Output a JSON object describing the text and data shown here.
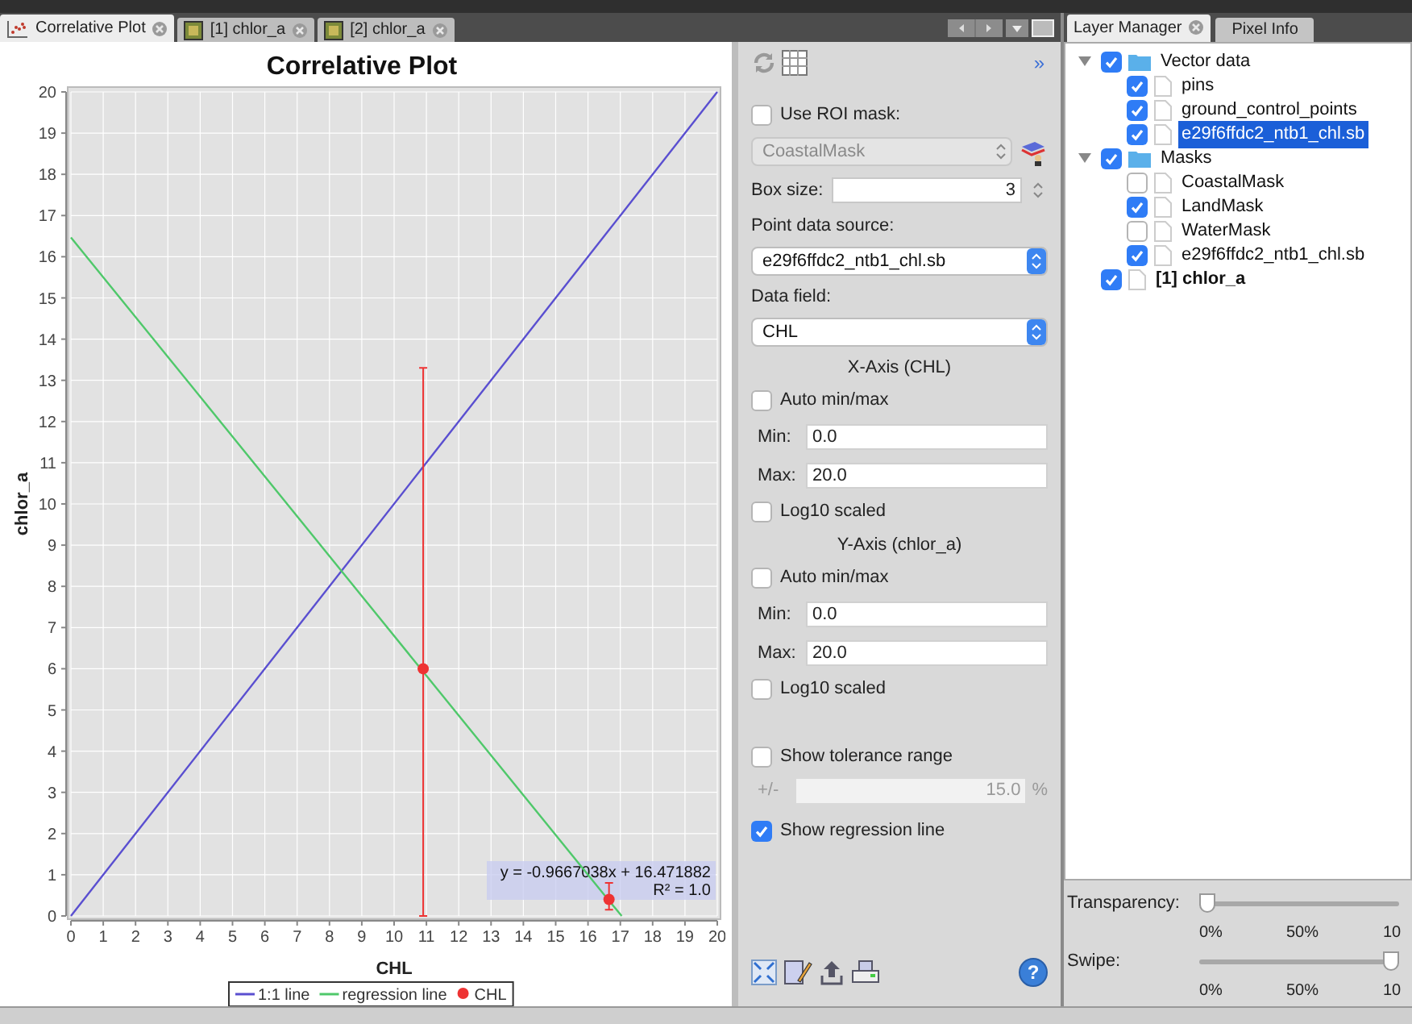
{
  "tabs": [
    {
      "label": "Correlative Plot",
      "kind": "plot",
      "selected": true
    },
    {
      "label": "[1] chlor_a",
      "kind": "image",
      "selected": false
    },
    {
      "label": "[2] chlor_a",
      "kind": "image",
      "selected": false
    }
  ],
  "chart": {
    "chart_data": {
      "type": "scatter",
      "title": "Correlative Plot",
      "xlabel": "CHL",
      "ylabel": "chlor_a",
      "x": [
        0,
        10.9,
        16.65,
        17.04,
        20
      ],
      "series": [
        {
          "name": "1:1 line",
          "type": "line",
          "color": "#5a4fd0",
          "values": [
            0,
            10.9,
            16.65,
            17.04,
            20
          ]
        },
        {
          "name": "regression line",
          "type": "line",
          "color": "#4fc86a",
          "values": [
            16.47,
            5.93,
            0.37,
            0,
            null
          ]
        },
        {
          "name": "CHL",
          "color": "#ee3333",
          "marker": "circle",
          "values": [
            null,
            6.0,
            0.4,
            null,
            null
          ],
          "errors": [
            null,
            [
              0,
              13.3
            ],
            [
              0.15,
              0.8
            ],
            null,
            null
          ]
        }
      ],
      "grid": true,
      "legend": true,
      "xlim": [
        0,
        20
      ],
      "ylim": [
        0,
        20
      ],
      "xticks": [
        0,
        1,
        2,
        3,
        4,
        5,
        6,
        7,
        8,
        9,
        10,
        11,
        12,
        13,
        14,
        15,
        16,
        17,
        18,
        19,
        20
      ],
      "yticks": [
        0,
        1,
        2,
        3,
        4,
        5,
        6,
        7,
        8,
        9,
        10,
        11,
        12,
        13,
        14,
        15,
        16,
        17,
        18,
        19,
        20
      ],
      "annotations": [
        "y = -0.9667038x + 16.471882",
        "R² = 1.0"
      ]
    }
  },
  "options": {
    "expand_symbol": "»",
    "controls": [
      {
        "kind": "checkbox",
        "label": "Use ROI mask:",
        "checked": false
      },
      {
        "kind": "select",
        "value": "CoastalMask",
        "disabled": true
      },
      {
        "kind": "spinner",
        "label": "Box size:",
        "value": "3"
      },
      {
        "kind": "label",
        "text": "Point data source:"
      },
      {
        "kind": "select",
        "value": "e29f6ffdc2_ntb1_chl.sb",
        "disabled": false
      },
      {
        "kind": "label",
        "text": "Data field:"
      },
      {
        "kind": "select",
        "value": "CHL",
        "disabled": false
      },
      {
        "kind": "heading",
        "text": "X-Axis (CHL)"
      },
      {
        "kind": "checkbox",
        "label": "Auto min/max",
        "checked": false
      },
      {
        "kind": "field",
        "label": "Min:",
        "value": "0.0"
      },
      {
        "kind": "field",
        "label": "Max:",
        "value": "20.0"
      },
      {
        "kind": "checkbox",
        "label": "Log10 scaled",
        "checked": false
      },
      {
        "kind": "heading",
        "text": "Y-Axis (chlor_a)"
      },
      {
        "kind": "checkbox",
        "label": "Auto min/max",
        "checked": false
      },
      {
        "kind": "field",
        "label": "Min:",
        "value": "0.0"
      },
      {
        "kind": "field",
        "label": "Max:",
        "value": "20.0"
      },
      {
        "kind": "checkbox",
        "label": "Log10 scaled",
        "checked": false
      }
    ],
    "tolerance": {
      "label": "Show tolerance range",
      "checked": false,
      "prefix": "+/-",
      "value": "15.0",
      "unit": "%",
      "disabled": true
    },
    "regression": {
      "label": "Show regression line",
      "checked": true
    },
    "help_glyph": "?"
  },
  "layer_tabs": [
    {
      "label": "Layer Manager",
      "selected": true,
      "closable": true
    },
    {
      "label": "Pixel Info",
      "selected": false,
      "closable": false
    }
  ],
  "layers": [
    {
      "label": "Vector data",
      "checked": true,
      "expanded": true,
      "selected": false,
      "kind": "folder",
      "children": [
        {
          "label": "pins",
          "checked": true,
          "selected": false,
          "kind": "node"
        },
        {
          "label": "ground_control_points",
          "checked": true,
          "selected": false,
          "kind": "node"
        },
        {
          "label": "e29f6ffdc2_ntb1_chl.sb",
          "checked": true,
          "selected": true,
          "kind": "node"
        }
      ]
    },
    {
      "label": "Masks",
      "checked": true,
      "expanded": true,
      "selected": false,
      "kind": "folder",
      "children": [
        {
          "label": "CoastalMask",
          "checked": false,
          "selected": false,
          "kind": "node"
        },
        {
          "label": "LandMask",
          "checked": true,
          "selected": false,
          "kind": "node"
        },
        {
          "label": "WaterMask",
          "checked": false,
          "selected": false,
          "kind": "node"
        },
        {
          "label": "e29f6ffdc2_ntb1_chl.sb",
          "checked": true,
          "selected": false,
          "kind": "node"
        }
      ]
    },
    {
      "label": "[1] chlor_a",
      "checked": true,
      "selected": false,
      "kind": "band"
    }
  ],
  "sliders": [
    {
      "label": "Transparency:",
      "level": 0,
      "ticks": [
        "0%",
        "50%",
        "10"
      ]
    },
    {
      "label": "Swipe:",
      "level": 1,
      "ticks": [
        "0%",
        "50%",
        "10"
      ]
    }
  ]
}
